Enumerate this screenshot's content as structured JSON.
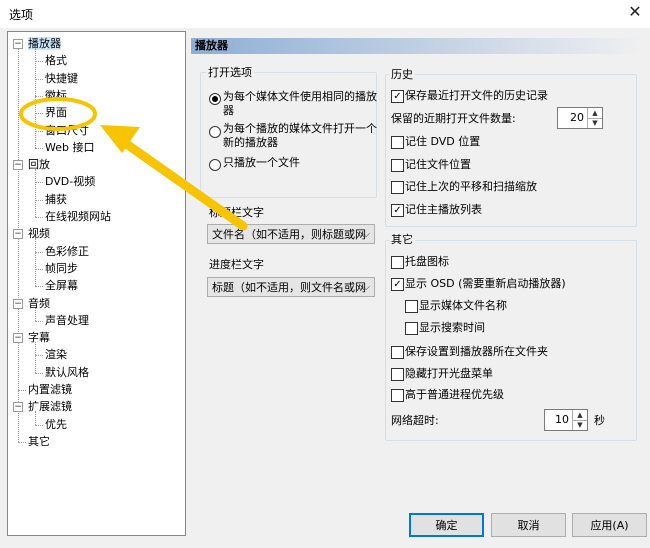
{
  "window": {
    "title": "选项",
    "close_glyph": "✕"
  },
  "tree": {
    "items": [
      {
        "label": "播放器",
        "level": 0,
        "toggle": "-",
        "selected": true
      },
      {
        "label": "格式",
        "level": 1
      },
      {
        "label": "快捷键",
        "level": 1
      },
      {
        "label": "徽标",
        "level": 1
      },
      {
        "label": "界面",
        "level": 1
      },
      {
        "label": "窗口尺寸",
        "level": 1
      },
      {
        "label": "Web 接口",
        "level": 1
      },
      {
        "label": "回放",
        "level": 0,
        "toggle": "-"
      },
      {
        "label": "DVD-视频",
        "level": 1
      },
      {
        "label": "捕获",
        "level": 1
      },
      {
        "label": "在线视频网站",
        "level": 1
      },
      {
        "label": "视频",
        "level": 0,
        "toggle": "-"
      },
      {
        "label": "色彩修正",
        "level": 1
      },
      {
        "label": "帧同步",
        "level": 1
      },
      {
        "label": "全屏幕",
        "level": 1
      },
      {
        "label": "音频",
        "level": 0,
        "toggle": "-"
      },
      {
        "label": "声音处理",
        "level": 1
      },
      {
        "label": "字幕",
        "level": 0,
        "toggle": "-"
      },
      {
        "label": "渲染",
        "level": 1
      },
      {
        "label": "默认风格",
        "level": 1
      },
      {
        "label": "内置滤镜",
        "level": 0
      },
      {
        "label": "扩展滤镜",
        "level": 0,
        "toggle": "-"
      },
      {
        "label": "优先",
        "level": 1
      },
      {
        "label": "其它",
        "level": 0
      }
    ]
  },
  "panel": {
    "header": "播放器",
    "open_options": {
      "title": "打开选项",
      "radio1": "为每个媒体文件使用相同的播放",
      "radio1b": "器",
      "radio2": "为每个播放的媒体文件打开一个",
      "radio2b": "新的播放器",
      "radio3": "只播放一个文件"
    },
    "titlebar_text": {
      "label": "标题栏文字",
      "value": "文件名（如不适用，则标题或网"
    },
    "seekbar_text": {
      "label": "进度栏文字",
      "value": "标题（如不适用，则文件名或网"
    },
    "history": {
      "title": "历史",
      "remember_recent": "保存最近打开文件的历史记录",
      "recent_count_label": "保留的近期打开文件数量:",
      "recent_count": "20",
      "remember_dvd": "记住 DVD 位置",
      "remember_file": "记住文件位置",
      "remember_pan": "记住上次的平移和扫描缩放",
      "remember_playlist": "记住主播放列表"
    },
    "other": {
      "title": "其它",
      "tray_icon": "托盘图标",
      "show_osd": "显示 OSD (需要重新启动播放器)",
      "show_filename": "显示媒体文件名称",
      "show_seektime": "显示搜索时间",
      "save_settings": "保存设置到播放器所在文件夹",
      "hide_disc_menu": "隐藏打开光盘菜单",
      "high_priority": "高于普通进程优先级",
      "network_timeout_label": "网络超时:",
      "network_timeout": "10",
      "network_timeout_unit": "秒"
    }
  },
  "buttons": {
    "ok": "确定",
    "cancel": "取消",
    "apply": "应用(A)"
  },
  "check_glyph": "✓",
  "annotation_color": "#f6c400"
}
